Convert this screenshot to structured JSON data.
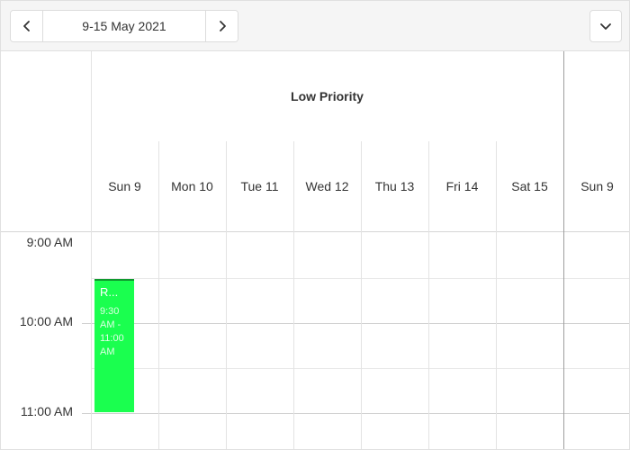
{
  "toolbar": {
    "date_range": "9-15 May 2021",
    "prev_icon": "chevron-left-icon",
    "next_icon": "chevron-right-icon",
    "view_icon": "chevron-down-icon"
  },
  "group": {
    "title": "Low Priority"
  },
  "days": [
    "Sun 9",
    "Mon 10",
    "Tue 11",
    "Wed 12",
    "Thu 13",
    "Fri 14",
    "Sat 15",
    "Sun 9"
  ],
  "times": [
    "9:00 AM",
    "10:00 AM",
    "11:00 AM"
  ],
  "appointment": {
    "title": "R...",
    "time_lines": [
      "9:30",
      "AM -",
      "11:00",
      "AM"
    ],
    "color": "#1aff4f"
  }
}
